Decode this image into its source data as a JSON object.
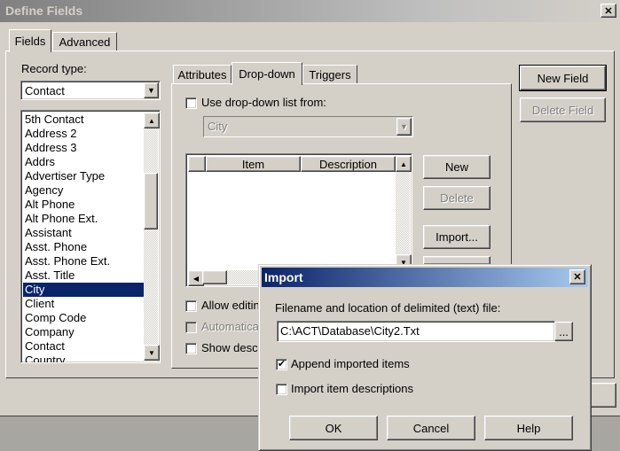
{
  "window": {
    "title": "Define Fields",
    "close_glyph": "✕"
  },
  "main_tabs": [
    "Fields",
    "Advanced"
  ],
  "record_type": {
    "label": "Record type:",
    "value": "Contact"
  },
  "fields_list": [
    "5th Contact",
    "Address 2",
    "Address 3",
    "Addrs",
    "Advertiser Type",
    "Agency",
    "Alt Phone",
    "Alt Phone Ext.",
    "Assistant",
    "Asst. Phone",
    "Asst. Phone Ext.",
    "Asst. Title",
    "City",
    "Client",
    "Comp Code",
    "Company",
    "Contact",
    "Country"
  ],
  "fields_selected": "City",
  "sub_tabs": [
    "Attributes",
    "Drop-down",
    "Triggers"
  ],
  "dropdown": {
    "use_list_label": "Use drop-down list from:",
    "use_list_combo": "City",
    "col_item": "Item",
    "col_description": "Description",
    "new_btn": "New",
    "delete_btn": "Delete",
    "import_btn": "Import...",
    "allow_editing": "Allow editin",
    "automatic": "Automatica",
    "show_desc": "Show desc"
  },
  "side_buttons": {
    "new_field": "New Field",
    "delete_field": "Delete Field"
  },
  "import_dialog": {
    "title": "Import",
    "file_label": "Filename and location of delimited (text) file:",
    "file_value": "C:\\ACT\\Database\\City2.Txt",
    "browse_btn": "...",
    "append_label": "Append imported items",
    "append_checked": true,
    "descriptions_label": "Import item descriptions",
    "descriptions_checked": false,
    "ok_btn": "OK",
    "cancel_btn": "Cancel",
    "help_btn": "Help"
  },
  "colors": {
    "selection": "#0a246a",
    "face": "#d4d0c8",
    "title_active_start": "#0a246a",
    "title_active_end": "#a6caf0"
  }
}
